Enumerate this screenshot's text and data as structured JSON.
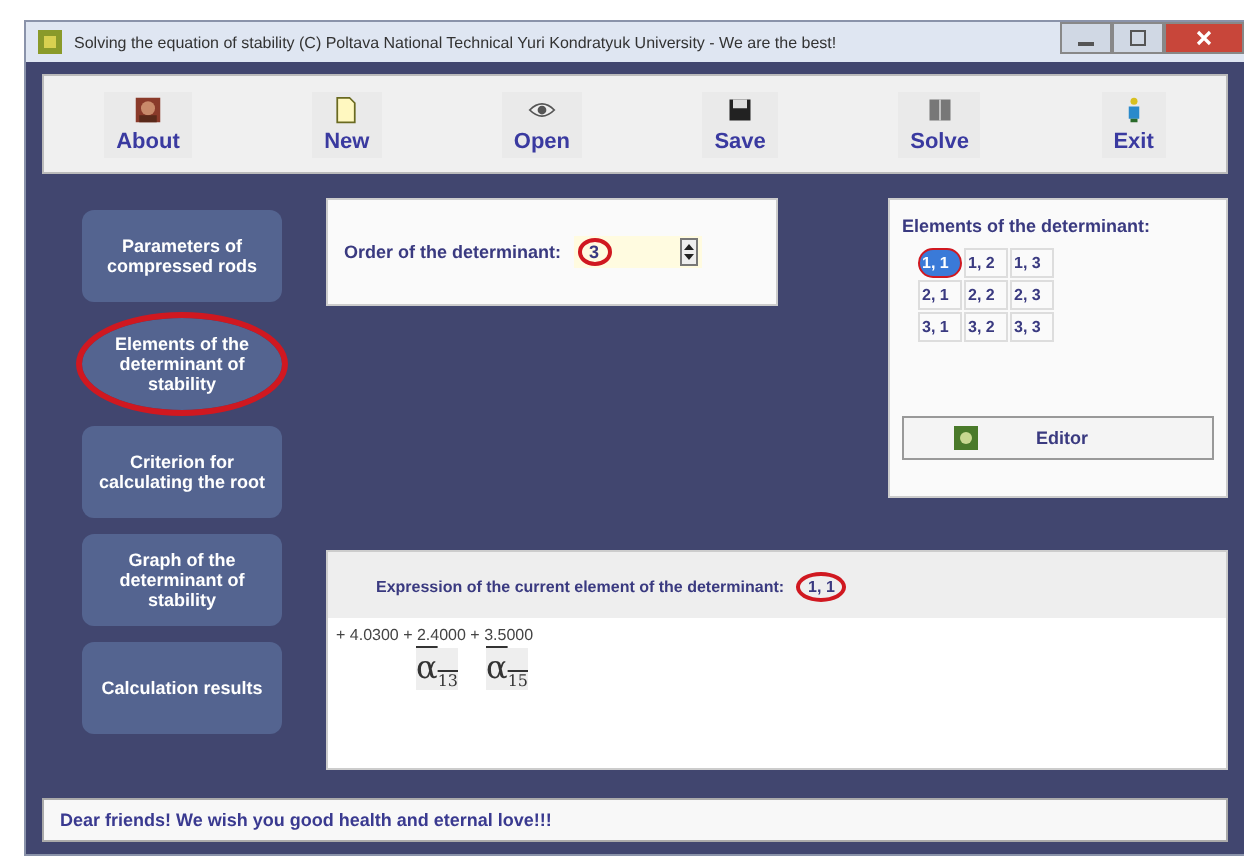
{
  "window": {
    "title": "Solving the equation of stability (C) Poltava National Technical Yuri Kondratyuk University - We are the best!"
  },
  "toolbar": [
    {
      "label": "About",
      "kind": "person"
    },
    {
      "label": "New",
      "kind": "new"
    },
    {
      "label": "Open",
      "kind": "open"
    },
    {
      "label": "Save",
      "kind": "save"
    },
    {
      "label": "Solve",
      "kind": "solve"
    },
    {
      "label": "Exit",
      "kind": "exit"
    }
  ],
  "sidebar": {
    "items": [
      {
        "label": "Parameters of compressed rods",
        "selected": false
      },
      {
        "label": "Elements of the determinant of stability",
        "selected": true
      },
      {
        "label": "Criterion for calculating the root",
        "selected": false
      },
      {
        "label": "Graph of the determinant of stability",
        "selected": false
      },
      {
        "label": "Calculation results",
        "selected": false
      }
    ]
  },
  "order": {
    "label": "Order of the determinant:",
    "value": "3",
    "circled": true
  },
  "elements": {
    "title": "Elements of the determinant:",
    "rows": [
      [
        {
          "text": "1, 1",
          "selected": true
        },
        {
          "text": "1, 2",
          "selected": false
        },
        {
          "text": "1, 3",
          "selected": false
        }
      ],
      [
        {
          "text": "2, 1",
          "selected": false
        },
        {
          "text": "2, 2",
          "selected": false
        },
        {
          "text": "2, 3",
          "selected": false
        }
      ],
      [
        {
          "text": "3, 1",
          "selected": false
        },
        {
          "text": "3, 2",
          "selected": false
        },
        {
          "text": "3, 3",
          "selected": false
        }
      ]
    ],
    "editor_button": "Editor"
  },
  "expression": {
    "label": "Expression of the current element of the determinant:",
    "current": "1, 1",
    "circled": true,
    "terms": "+ 4.0300 + 2.4000 + 3.5000",
    "symbols": [
      "α$_{13}$",
      "α$_{15}$"
    ]
  },
  "status_bar": "Dear friends! We wish you good health and eternal love!!!"
}
